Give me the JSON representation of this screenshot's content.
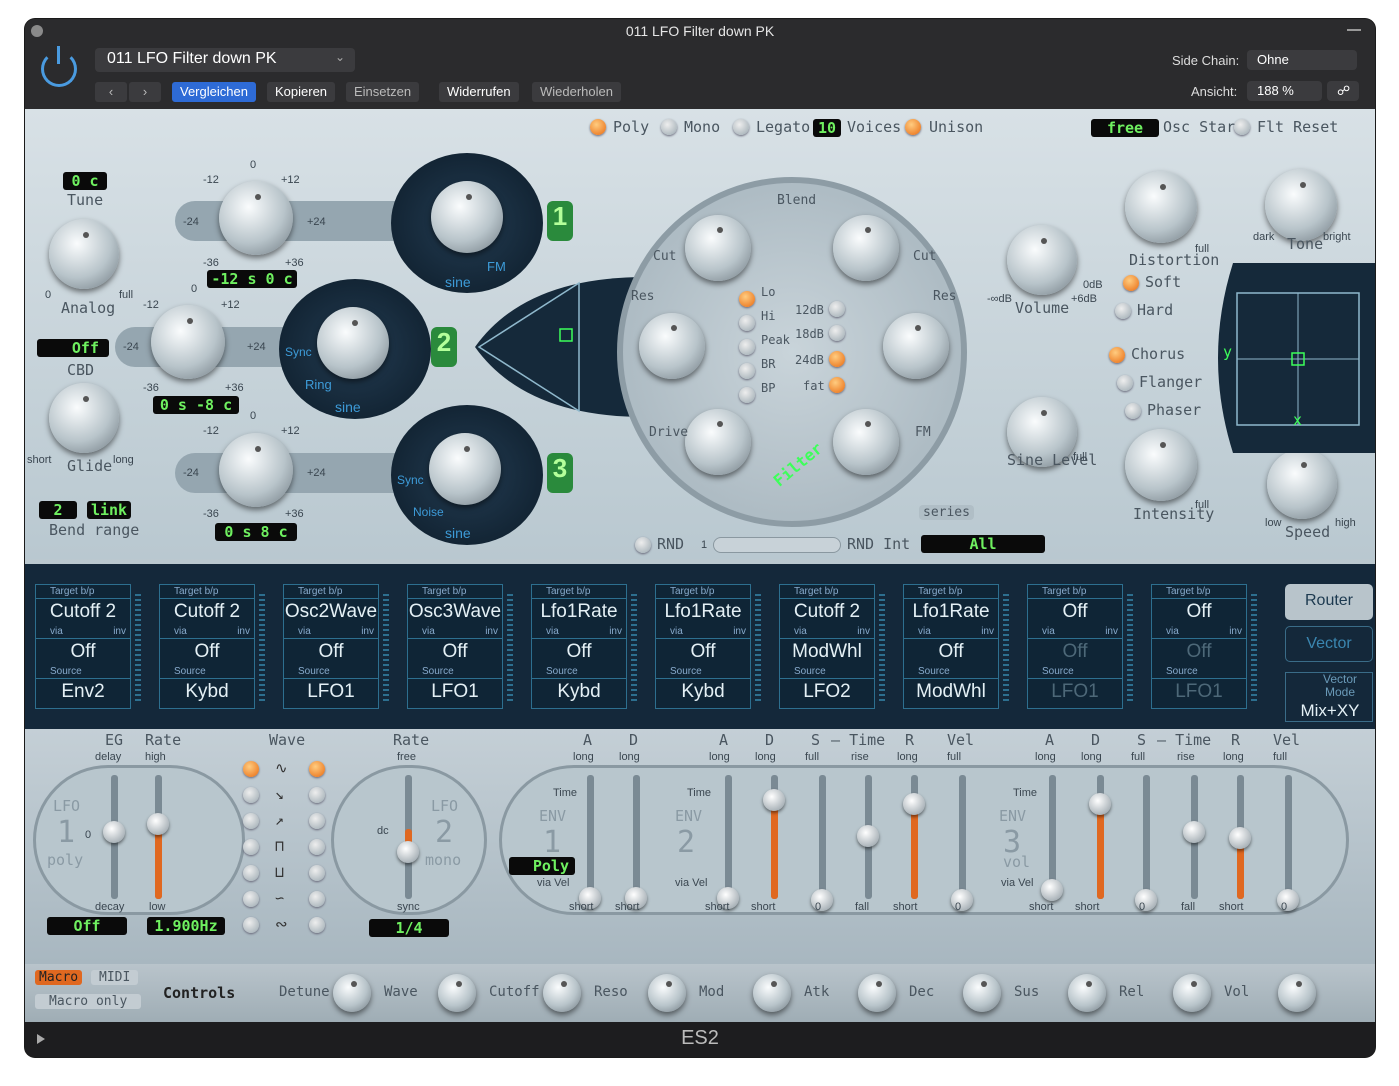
{
  "window": {
    "title": "011 LFO Filter down PK",
    "footer": "ES2"
  },
  "header": {
    "preset": "011 LFO Filter down PK",
    "compare": "Vergleichen",
    "copy": "Kopieren",
    "paste": "Einsetzen",
    "undo": "Widerrufen",
    "redo": "Wiederholen",
    "sidechain_label": "Side Chain:",
    "sidechain_value": "Ohne",
    "view_label": "Ansicht:",
    "view_value": "188 %"
  },
  "voice": {
    "poly": "Poly",
    "mono": "Mono",
    "legato": "Legato",
    "voices_count": "10",
    "voices": "Voices",
    "unison": "Unison",
    "osc_start_value": "free",
    "osc_start": "Osc Start",
    "flt_reset": "Flt Reset"
  },
  "global": {
    "tune_value": "0 c",
    "tune": "Tune",
    "analog": "Analog",
    "cbd_value": "Off",
    "cbd": "CBD",
    "glide": "Glide",
    "short": "short",
    "long": "long",
    "bend_down": "2",
    "bend_link": "link",
    "bend_range": "Bend range",
    "zero": "0",
    "full": "full"
  },
  "osc": [
    {
      "num": "1",
      "display": "-12 s 0 c",
      "wave": "sine",
      "fm": "FM"
    },
    {
      "num": "2",
      "display": "0 s  -8 c",
      "wave": "sine",
      "ring": "Ring",
      "sync": "Sync"
    },
    {
      "num": "3",
      "display": "0 s  8 c",
      "wave": "sine",
      "noise": "Noise",
      "sync": "Sync"
    }
  ],
  "pitch_labels": {
    "m12": "-12",
    "p12": "+12",
    "m24": "-24",
    "p24": "+24",
    "m36": "-36",
    "p36": "+36",
    "zero": "0"
  },
  "filter": {
    "blend": "Blend",
    "cut": "Cut",
    "res": "Res",
    "drive": "Drive",
    "fm": "FM",
    "series": "series",
    "label": "Filter",
    "lo": "Lo",
    "hi": "Hi",
    "peak": "Peak",
    "br": "BR",
    "bp": "BP",
    "db12": "12dB",
    "db18": "18dB",
    "db24": "24dB",
    "fat": "fat"
  },
  "output": {
    "volume": "Volume",
    "minus_db": "-∞dB",
    "zero_db": "0dB",
    "plus_db": "+6dB",
    "sine_level": "Sine Level",
    "distortion": "Distortion",
    "soft": "Soft",
    "hard": "Hard",
    "tone": "Tone",
    "dark": "dark",
    "bright": "bright",
    "chorus": "Chorus",
    "flanger": "Flanger",
    "phaser": "Phaser",
    "intensity": "Intensity",
    "speed": "Speed",
    "low": "low",
    "high": "high",
    "x": "x",
    "y": "y"
  },
  "rnd": {
    "label": "RND",
    "int": "RND Int",
    "value": "All",
    "one": "1"
  },
  "router": {
    "slots": [
      {
        "target": "Cutoff 2",
        "via": "Off",
        "source": "Env2"
      },
      {
        "target": "Cutoff 2",
        "via": "Off",
        "source": "Kybd"
      },
      {
        "target": "Osc2Wave",
        "via": "Off",
        "source": "LFO1"
      },
      {
        "target": "Osc3Wave",
        "via": "Off",
        "source": "LFO1"
      },
      {
        "target": "Lfo1Rate",
        "via": "Off",
        "source": "Kybd"
      },
      {
        "target": "Lfo1Rate",
        "via": "Off",
        "source": "Kybd"
      },
      {
        "target": "Cutoff 2",
        "via": "ModWhl",
        "source": "LFO2"
      },
      {
        "target": "Lfo1Rate",
        "via": "Off",
        "source": "ModWhl"
      },
      {
        "target": "Off",
        "via": "Off",
        "source": "LFO1"
      },
      {
        "target": "Off",
        "via": "Off",
        "source": "LFO1"
      }
    ],
    "hdr_target": "Target",
    "hdr_bp": "b/p",
    "hdr_via": "via",
    "hdr_inv": "inv",
    "hdr_source": "Source",
    "router_btn": "Router",
    "vector_btn": "Vector",
    "vector_mode": "Vector Mode",
    "vector_mode_value": "Mix+XY"
  },
  "lfo1": {
    "eg": "EG",
    "rate": "Rate",
    "delay": "delay",
    "high": "high",
    "decay": "decay",
    "low": "low",
    "name": "LFO",
    "num": "1",
    "poly": "poly",
    "eg_value": "Off",
    "rate_value": "1.900Hz",
    "zero": "0"
  },
  "wave": {
    "label": "Wave"
  },
  "lfo2": {
    "rate": "Rate",
    "free": "free",
    "dc": "dc",
    "sync": "sync",
    "name": "LFO",
    "num": "2",
    "mono": "mono",
    "value": "1/4"
  },
  "env1": {
    "a": "A",
    "d": "D",
    "long": "long",
    "time": "Time",
    "name": "ENV",
    "num": "1",
    "mode": "Poly",
    "via_vel": "via Vel",
    "short": "short"
  },
  "env2": {
    "a": "A",
    "d": "D",
    "s": "S",
    "time": "Time",
    "r": "R",
    "vel": "Vel",
    "long": "long",
    "full": "full",
    "rise": "rise",
    "fall": "fall",
    "short": "short",
    "zero": "0",
    "name": "ENV",
    "num": "2",
    "via_vel": "via Vel"
  },
  "env3": {
    "a": "A",
    "d": "D",
    "s": "S",
    "time": "Time",
    "r": "R",
    "vel": "Vel",
    "long": "long",
    "full": "full",
    "rise": "rise",
    "fall": "fall",
    "short": "short",
    "zero": "0",
    "name": "ENV",
    "num": "3",
    "vol": "vol",
    "via_vel": "via Vel"
  },
  "controls": {
    "macro": "Macro",
    "midi": "MIDI",
    "macro_only": "Macro only",
    "label": "Controls",
    "knobs": [
      "Detune",
      "Wave",
      "Cutoff",
      "Reso",
      "Mod",
      "Atk",
      "Dec",
      "Sus",
      "Rel",
      "Vol"
    ]
  }
}
